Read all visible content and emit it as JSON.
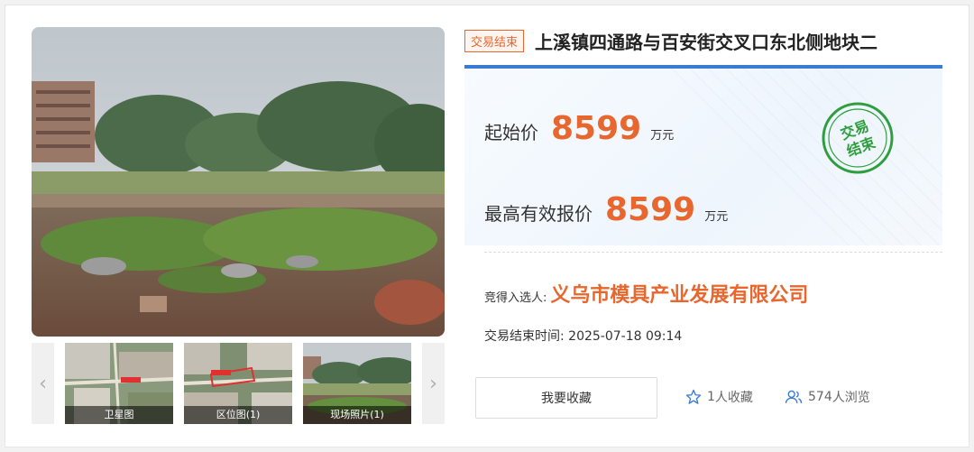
{
  "listing": {
    "status_tag": "交易结束",
    "title": "上溪镇四通路与百安街交叉口东北侧地块二"
  },
  "prices": {
    "start_label": "起始价",
    "start_value": "8599",
    "start_unit": "万元",
    "highest_label": "最高有效报价",
    "highest_value": "8599",
    "highest_unit": "万元",
    "stamp_text_line1": "交易",
    "stamp_text_line2": "结束"
  },
  "result": {
    "winner_label": "竞得入选人:",
    "winner_name": "义乌市模具产业发展有限公司",
    "end_time_label": "交易结束时间:",
    "end_time_value": "2025-07-18 09:14"
  },
  "actions": {
    "favorite_button": "我要收藏",
    "favorites_count": "1",
    "favorites_suffix": "人收藏",
    "views_count": "574",
    "views_suffix": "人浏览"
  },
  "gallery": {
    "prev_arrow": "‹",
    "next_arrow": "›",
    "thumbs": [
      {
        "caption": "卫星图"
      },
      {
        "caption": "区位图(1)"
      },
      {
        "caption": "现场照片(1)"
      }
    ]
  },
  "colors": {
    "accent_orange": "#e8672f",
    "accent_blue": "#3a7bd5",
    "stamp_green": "#2e9e3f"
  }
}
